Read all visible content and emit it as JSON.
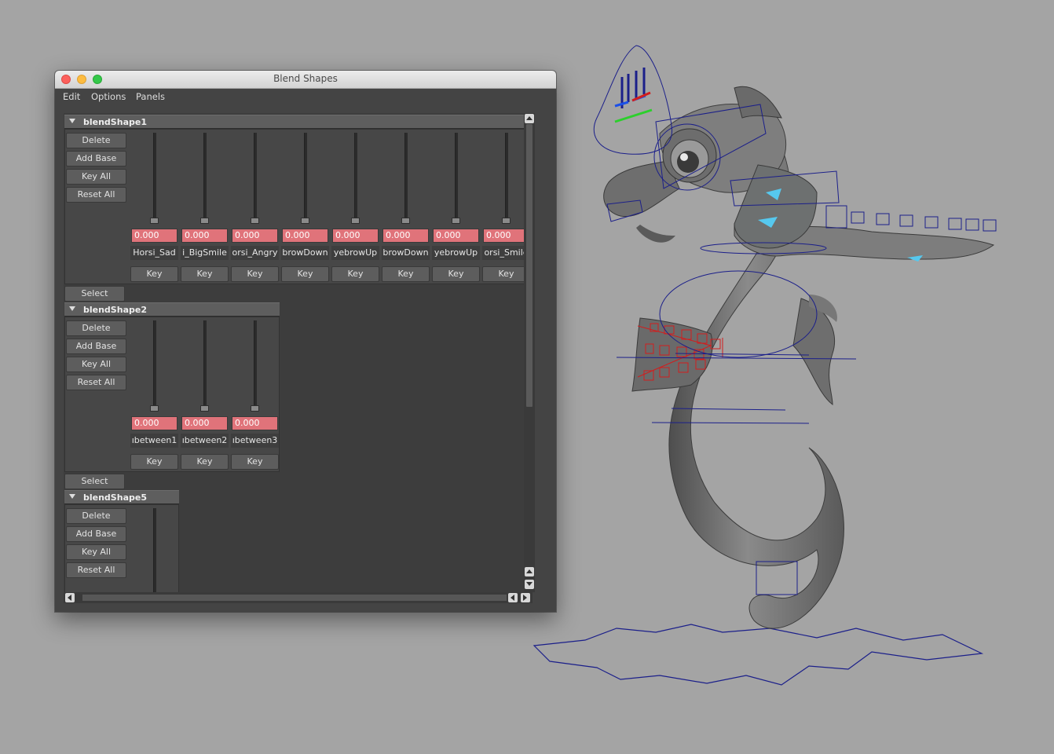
{
  "window": {
    "title": "Blend Shapes"
  },
  "menu": [
    "Edit",
    "Options",
    "Panels"
  ],
  "groups": [
    {
      "name": "blendShape1",
      "buttons": [
        "Delete",
        "Add Base",
        "Key All",
        "Reset All"
      ],
      "select_label": "Select",
      "targets": [
        {
          "value": "0.000",
          "name": "Horsi_Sad",
          "key": "Key"
        },
        {
          "value": "0.000",
          "name": "i_BigSmile",
          "key": "Key"
        },
        {
          "value": "0.000",
          "name": "orsi_Angry",
          "key": "Key"
        },
        {
          "value": "0.000",
          "name": "browDown",
          "key": "Key"
        },
        {
          "value": "0.000",
          "name": "yebrowUp",
          "key": "Key"
        },
        {
          "value": "0.000",
          "name": "browDown",
          "key": "Key"
        },
        {
          "value": "0.000",
          "name": "yebrowUp",
          "key": "Key"
        },
        {
          "value": "0.000",
          "name": "orsi_Smile",
          "key": "Key"
        }
      ]
    },
    {
      "name": "blendShape2",
      "buttons": [
        "Delete",
        "Add Base",
        "Key All",
        "Reset All"
      ],
      "select_label": "Select",
      "targets": [
        {
          "value": "0.000",
          "name": "ıbetween1",
          "key": "Key"
        },
        {
          "value": "0.000",
          "name": "ıbetween2",
          "key": "Key"
        },
        {
          "value": "0.000",
          "name": "ıbetween3",
          "key": "Key"
        }
      ]
    },
    {
      "name": "blendShape5",
      "buttons": [
        "Delete",
        "Add Base",
        "Key All",
        "Reset All"
      ]
    }
  ],
  "colors": {
    "value_field": "#e0737a",
    "control_curve": "#1b1f8a",
    "selected_curve": "#d21d1d",
    "viewport_bg": "#a4a4a4"
  }
}
